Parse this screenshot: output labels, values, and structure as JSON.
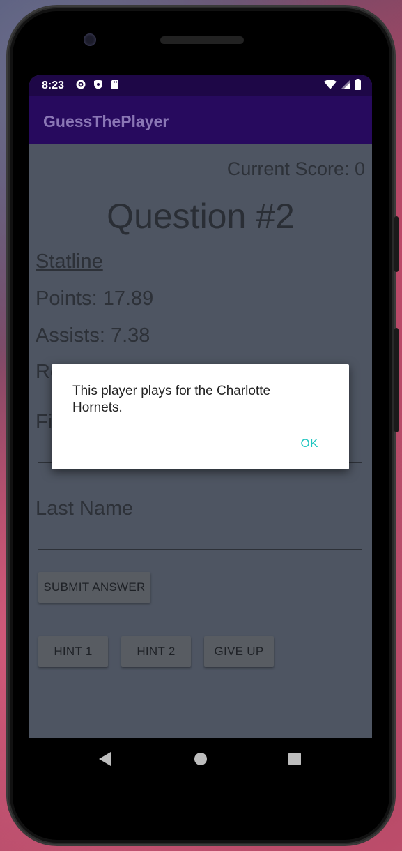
{
  "status_bar": {
    "time": "8:23"
  },
  "app_bar": {
    "title": "GuessThePlayer"
  },
  "main": {
    "score": "Current Score: 0",
    "question": "Question #2",
    "statline_label": "Statline",
    "points": "Points: 17.89",
    "assists": "Assists: 7.38",
    "rebounds_partial": "Re",
    "first_name_partial": "Fi",
    "last_name_placeholder": "Last Name",
    "submit_label": "SUBMIT ANSWER",
    "hint1_label": "HINT 1",
    "hint2_label": "HINT 2",
    "give_up_label": "GIVE UP"
  },
  "dialog": {
    "message": "This player plays for the Charlotte Hornets.",
    "ok_label": "OK"
  },
  "colors": {
    "status_bar": "#1e0747",
    "app_bar": "#270a5e",
    "screen_dim": "#4e5562",
    "dialog_accent": "#1fc6c0"
  }
}
